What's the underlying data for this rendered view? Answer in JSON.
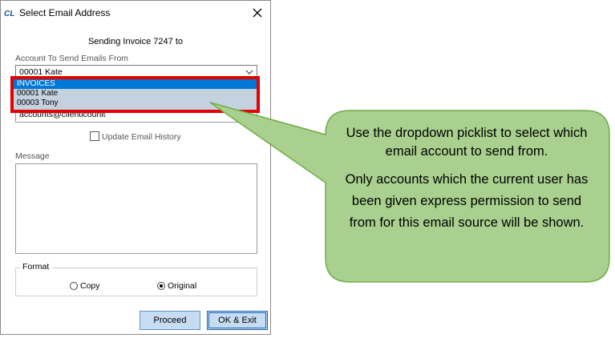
{
  "dialog": {
    "title": "Select Email Address",
    "sending_text": "Sending Invoice 7247 to",
    "account_label": "Account To Send Emails From",
    "account_value": "00001  Kate",
    "email_value": "accounts@clienticounit",
    "update_history_label": "Update Email History",
    "message_label": "Message",
    "format_label": "Format",
    "format_options": [
      {
        "label": "Copy",
        "selected": false
      },
      {
        "label": "Original",
        "selected": true
      }
    ],
    "proceed_label": "Proceed",
    "ok_exit_label": "OK & Exit"
  },
  "dropdown": {
    "items": [
      {
        "label": "INVOICES",
        "selected": true
      },
      {
        "label": "00001  Kate",
        "selected": false
      },
      {
        "label": "00003  Tony",
        "selected": false
      }
    ]
  },
  "callout": {
    "line1": "Use the dropdown picklist to select which email account to send from.",
    "line2": "Only accounts which the current user has been given express permission to send from for this email source will be shown."
  },
  "colors": {
    "highlight": "#e20000",
    "callout_fill": "#a9d08e",
    "callout_border": "#70ad47",
    "selected_item": "#0078d7",
    "button_fill": "#c6dcf3"
  }
}
